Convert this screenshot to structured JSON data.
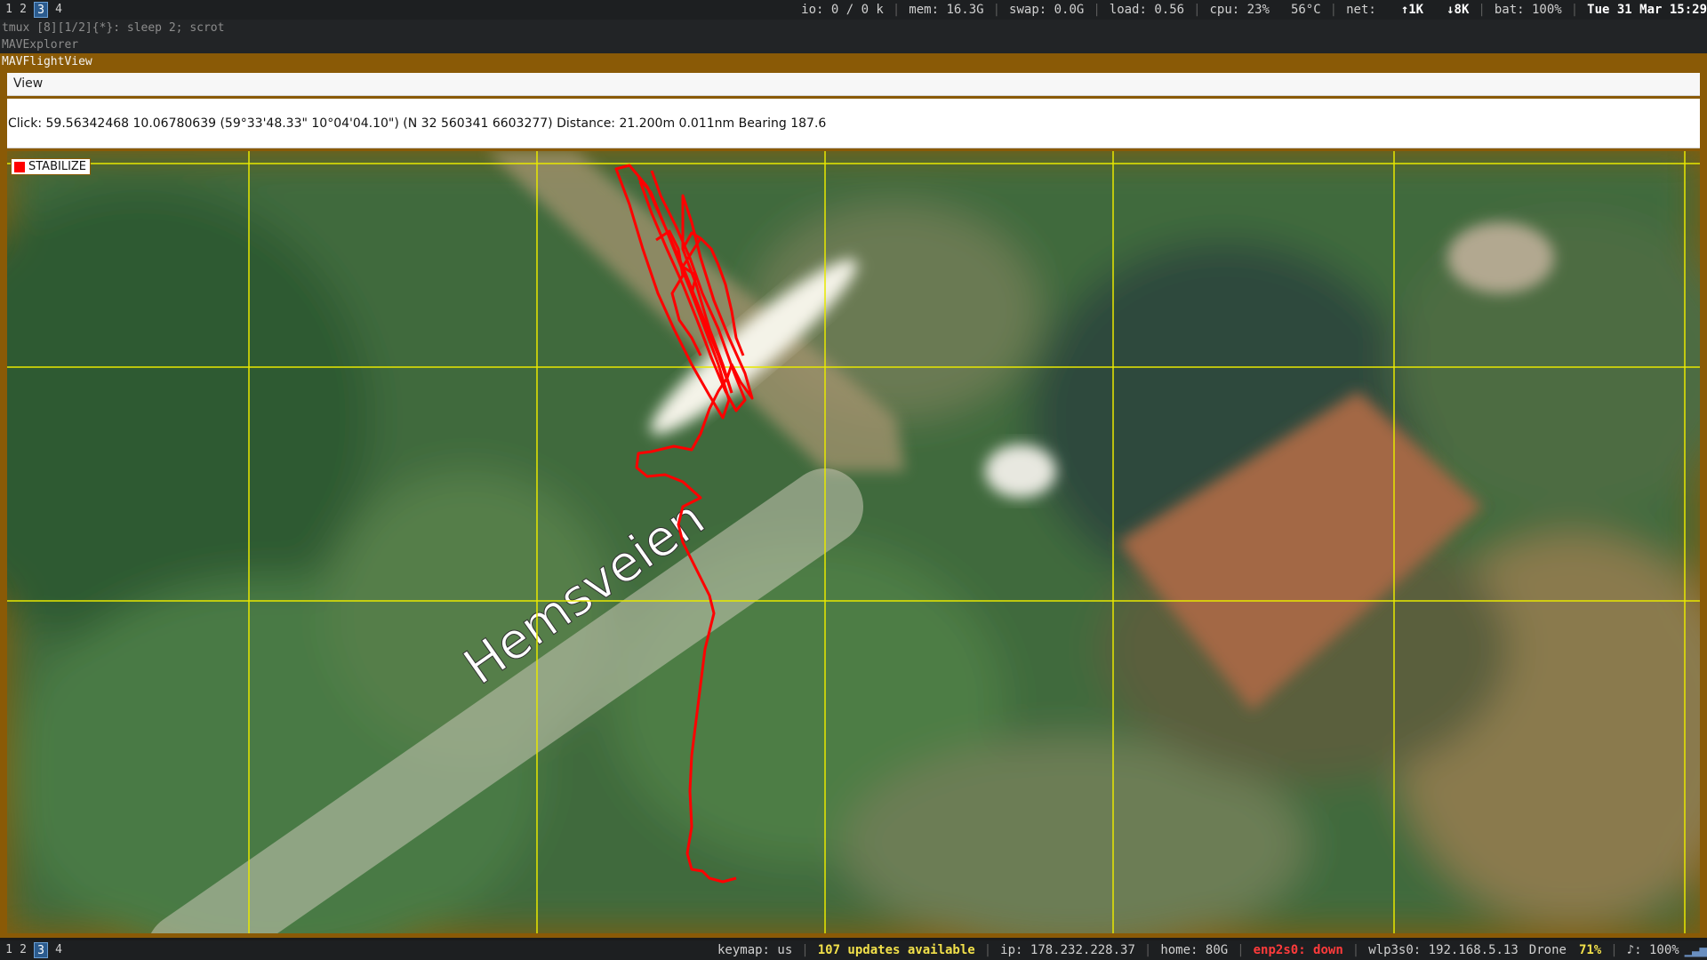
{
  "topbar": {
    "workspaces": [
      "1",
      "2",
      "3",
      "4"
    ],
    "active_workspace": "3",
    "status": {
      "io": "io: 0   /   0 k",
      "mem": "mem: 16.3G",
      "swap": "swap: 0.0G",
      "load": "load: 0.56",
      "cpu": "cpu:  23%",
      "temp": "56°C",
      "net_label": "net:",
      "net_up": "↑1K",
      "net_down": "↓8K",
      "bat": "bat: 100%",
      "datetime": "Tue 31 Mar 15:29"
    }
  },
  "titles": {
    "tmux": "tmux [8][1/2]{*}:  sleep 2; scrot",
    "explorer": "MAVExplorer",
    "flightview": "MAVFlightView"
  },
  "menu": {
    "view": "View"
  },
  "info": {
    "click_text": "Click: 59.56342468 10.06780639 (59°33'48.33\" 10°04'04.10\") (N 32 560341 6603277)  Distance: 21.200m 0.011nm Bearing 187.6"
  },
  "map": {
    "flight_mode": "STABILIZE",
    "road_label": "Hemsveien",
    "track_color": "#ff0000",
    "grid_color": "#e8e800"
  },
  "bottombar": {
    "workspaces": [
      "1",
      "2",
      "3",
      "4"
    ],
    "active_workspace": "3",
    "keymap": "keymap: us",
    "updates": "107 updates available",
    "ip": "ip: 178.232.228.37",
    "home": "home: 80G",
    "enp": "enp2s0: down",
    "wlp": "wlp3s0: 192.168.5.13",
    "wifi_name": "Drone",
    "wifi_pct": "71%",
    "volume": "♪: 100%"
  }
}
